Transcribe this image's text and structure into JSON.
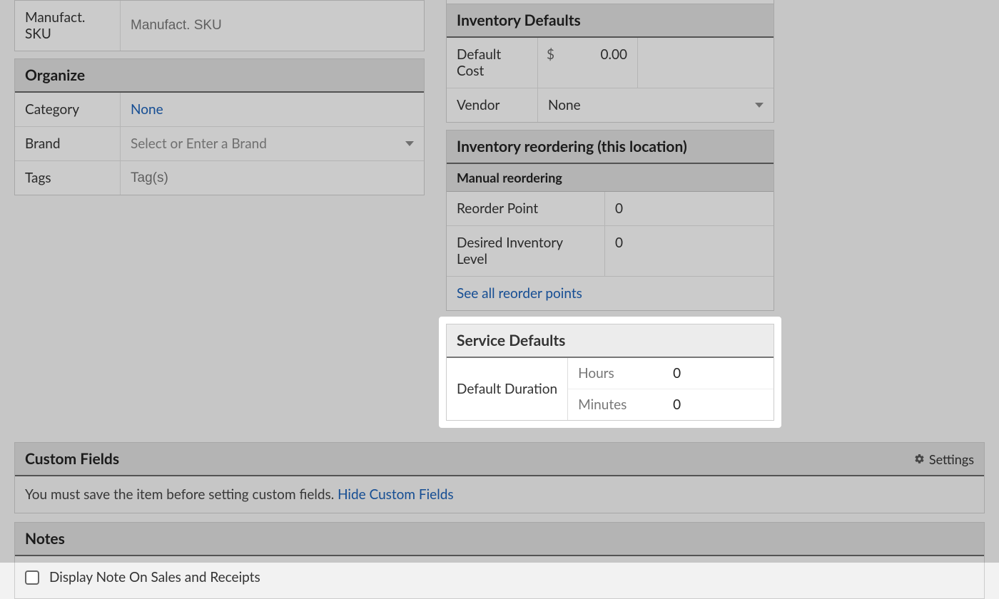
{
  "left": {
    "manufact_sku_label": "Manufact. SKU",
    "manufact_sku_placeholder": "Manufact. SKU",
    "organize": {
      "header": "Organize",
      "category_label": "Category",
      "category_value": "None",
      "brand_label": "Brand",
      "brand_placeholder": "Select or Enter a Brand",
      "tags_label": "Tags",
      "tags_placeholder": "Tag(s)"
    }
  },
  "right": {
    "inventory_defaults": {
      "header": "Inventory Defaults",
      "default_cost_label": "Default Cost",
      "currency": "$",
      "default_cost_value": "0.00",
      "vendor_label": "Vendor",
      "vendor_value": "None"
    },
    "reordering": {
      "header": "Inventory reordering (this location)",
      "manual_label": "Manual reordering",
      "reorder_point_label": "Reorder Point",
      "reorder_point_value": "0",
      "desired_level_label": "Desired Inventory Level",
      "desired_level_value": "0",
      "see_all_link": "See all reorder points"
    },
    "service_defaults": {
      "header": "Service Defaults",
      "duration_label": "Default Duration",
      "hours_label": "Hours",
      "hours_value": "0",
      "minutes_label": "Minutes",
      "minutes_value": "0"
    }
  },
  "custom_fields": {
    "header": "Custom Fields",
    "settings_label": "Settings",
    "message_prefix": "You must save the item before setting custom fields. ",
    "hide_link": "Hide Custom Fields"
  },
  "notes": {
    "header": "Notes",
    "display_label": "Display Note On Sales and Receipts"
  }
}
